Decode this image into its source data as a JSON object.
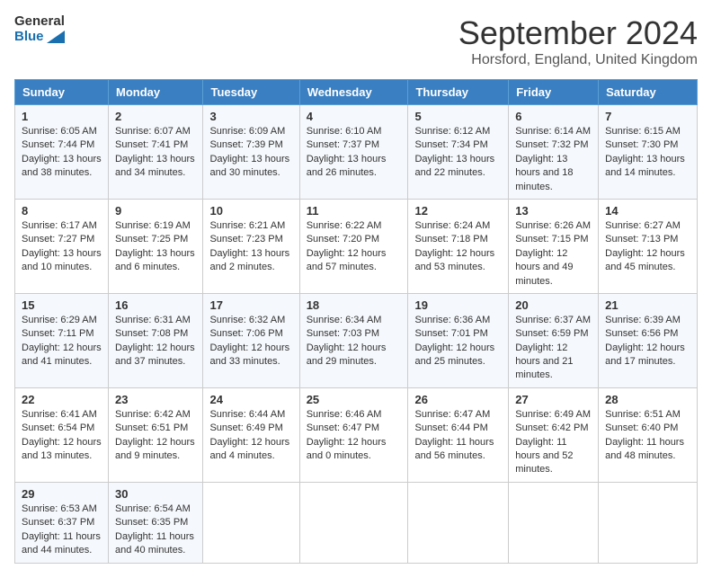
{
  "logo": {
    "line1": "General",
    "line2": "Blue"
  },
  "title": "September 2024",
  "location": "Horsford, England, United Kingdom",
  "weekdays": [
    "Sunday",
    "Monday",
    "Tuesday",
    "Wednesday",
    "Thursday",
    "Friday",
    "Saturday"
  ],
  "weeks": [
    [
      {
        "day": "1",
        "sunrise": "Sunrise: 6:05 AM",
        "sunset": "Sunset: 7:44 PM",
        "daylight": "Daylight: 13 hours and 38 minutes."
      },
      {
        "day": "2",
        "sunrise": "Sunrise: 6:07 AM",
        "sunset": "Sunset: 7:41 PM",
        "daylight": "Daylight: 13 hours and 34 minutes."
      },
      {
        "day": "3",
        "sunrise": "Sunrise: 6:09 AM",
        "sunset": "Sunset: 7:39 PM",
        "daylight": "Daylight: 13 hours and 30 minutes."
      },
      {
        "day": "4",
        "sunrise": "Sunrise: 6:10 AM",
        "sunset": "Sunset: 7:37 PM",
        "daylight": "Daylight: 13 hours and 26 minutes."
      },
      {
        "day": "5",
        "sunrise": "Sunrise: 6:12 AM",
        "sunset": "Sunset: 7:34 PM",
        "daylight": "Daylight: 13 hours and 22 minutes."
      },
      {
        "day": "6",
        "sunrise": "Sunrise: 6:14 AM",
        "sunset": "Sunset: 7:32 PM",
        "daylight": "Daylight: 13 hours and 18 minutes."
      },
      {
        "day": "7",
        "sunrise": "Sunrise: 6:15 AM",
        "sunset": "Sunset: 7:30 PM",
        "daylight": "Daylight: 13 hours and 14 minutes."
      }
    ],
    [
      {
        "day": "8",
        "sunrise": "Sunrise: 6:17 AM",
        "sunset": "Sunset: 7:27 PM",
        "daylight": "Daylight: 13 hours and 10 minutes."
      },
      {
        "day": "9",
        "sunrise": "Sunrise: 6:19 AM",
        "sunset": "Sunset: 7:25 PM",
        "daylight": "Daylight: 13 hours and 6 minutes."
      },
      {
        "day": "10",
        "sunrise": "Sunrise: 6:21 AM",
        "sunset": "Sunset: 7:23 PM",
        "daylight": "Daylight: 13 hours and 2 minutes."
      },
      {
        "day": "11",
        "sunrise": "Sunrise: 6:22 AM",
        "sunset": "Sunset: 7:20 PM",
        "daylight": "Daylight: 12 hours and 57 minutes."
      },
      {
        "day": "12",
        "sunrise": "Sunrise: 6:24 AM",
        "sunset": "Sunset: 7:18 PM",
        "daylight": "Daylight: 12 hours and 53 minutes."
      },
      {
        "day": "13",
        "sunrise": "Sunrise: 6:26 AM",
        "sunset": "Sunset: 7:15 PM",
        "daylight": "Daylight: 12 hours and 49 minutes."
      },
      {
        "day": "14",
        "sunrise": "Sunrise: 6:27 AM",
        "sunset": "Sunset: 7:13 PM",
        "daylight": "Daylight: 12 hours and 45 minutes."
      }
    ],
    [
      {
        "day": "15",
        "sunrise": "Sunrise: 6:29 AM",
        "sunset": "Sunset: 7:11 PM",
        "daylight": "Daylight: 12 hours and 41 minutes."
      },
      {
        "day": "16",
        "sunrise": "Sunrise: 6:31 AM",
        "sunset": "Sunset: 7:08 PM",
        "daylight": "Daylight: 12 hours and 37 minutes."
      },
      {
        "day": "17",
        "sunrise": "Sunrise: 6:32 AM",
        "sunset": "Sunset: 7:06 PM",
        "daylight": "Daylight: 12 hours and 33 minutes."
      },
      {
        "day": "18",
        "sunrise": "Sunrise: 6:34 AM",
        "sunset": "Sunset: 7:03 PM",
        "daylight": "Daylight: 12 hours and 29 minutes."
      },
      {
        "day": "19",
        "sunrise": "Sunrise: 6:36 AM",
        "sunset": "Sunset: 7:01 PM",
        "daylight": "Daylight: 12 hours and 25 minutes."
      },
      {
        "day": "20",
        "sunrise": "Sunrise: 6:37 AM",
        "sunset": "Sunset: 6:59 PM",
        "daylight": "Daylight: 12 hours and 21 minutes."
      },
      {
        "day": "21",
        "sunrise": "Sunrise: 6:39 AM",
        "sunset": "Sunset: 6:56 PM",
        "daylight": "Daylight: 12 hours and 17 minutes."
      }
    ],
    [
      {
        "day": "22",
        "sunrise": "Sunrise: 6:41 AM",
        "sunset": "Sunset: 6:54 PM",
        "daylight": "Daylight: 12 hours and 13 minutes."
      },
      {
        "day": "23",
        "sunrise": "Sunrise: 6:42 AM",
        "sunset": "Sunset: 6:51 PM",
        "daylight": "Daylight: 12 hours and 9 minutes."
      },
      {
        "day": "24",
        "sunrise": "Sunrise: 6:44 AM",
        "sunset": "Sunset: 6:49 PM",
        "daylight": "Daylight: 12 hours and 4 minutes."
      },
      {
        "day": "25",
        "sunrise": "Sunrise: 6:46 AM",
        "sunset": "Sunset: 6:47 PM",
        "daylight": "Daylight: 12 hours and 0 minutes."
      },
      {
        "day": "26",
        "sunrise": "Sunrise: 6:47 AM",
        "sunset": "Sunset: 6:44 PM",
        "daylight": "Daylight: 11 hours and 56 minutes."
      },
      {
        "day": "27",
        "sunrise": "Sunrise: 6:49 AM",
        "sunset": "Sunset: 6:42 PM",
        "daylight": "Daylight: 11 hours and 52 minutes."
      },
      {
        "day": "28",
        "sunrise": "Sunrise: 6:51 AM",
        "sunset": "Sunset: 6:40 PM",
        "daylight": "Daylight: 11 hours and 48 minutes."
      }
    ],
    [
      {
        "day": "29",
        "sunrise": "Sunrise: 6:53 AM",
        "sunset": "Sunset: 6:37 PM",
        "daylight": "Daylight: 11 hours and 44 minutes."
      },
      {
        "day": "30",
        "sunrise": "Sunrise: 6:54 AM",
        "sunset": "Sunset: 6:35 PM",
        "daylight": "Daylight: 11 hours and 40 minutes."
      },
      null,
      null,
      null,
      null,
      null
    ]
  ]
}
